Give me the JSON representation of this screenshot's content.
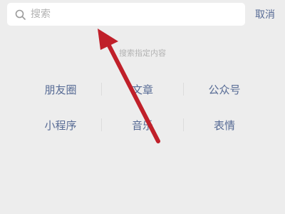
{
  "search": {
    "placeholder": "搜索",
    "value": "",
    "icon": "search-icon"
  },
  "cancel_label": "取消",
  "hint": "搜索指定内容",
  "categories": [
    [
      "朋友圈",
      "文章",
      "公众号"
    ],
    [
      "小程序",
      "音乐",
      "表情"
    ]
  ],
  "annotation": {
    "type": "arrow",
    "color": "#c0202a"
  }
}
